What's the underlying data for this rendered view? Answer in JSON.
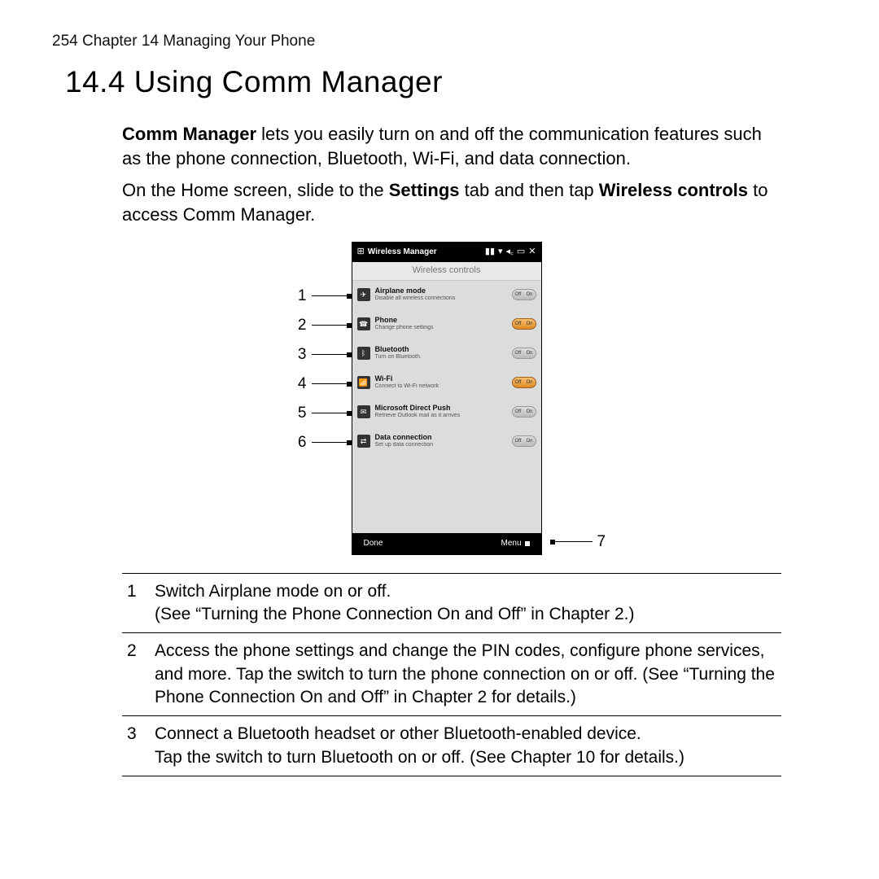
{
  "header": {
    "running": "254  Chapter 14  Managing Your Phone",
    "title": "14.4  Using Comm Manager"
  },
  "intro": {
    "p1_lead": "Comm Manager",
    "p1_rest": " lets you easily turn on and off the communication features such as the phone connection, Bluetooth, Wi-Fi, and data connection.",
    "p2_a": "On the Home screen, slide to the ",
    "p2_b": "Settings",
    "p2_c": " tab and then tap ",
    "p2_d": "Wireless controls",
    "p2_e": " to access Comm Manager."
  },
  "phone": {
    "status_title": "Wireless Manager",
    "subhead": "Wireless controls",
    "items": [
      {
        "icon": "✈",
        "title": "Airplane mode",
        "desc": "Disable all wireless connections",
        "state": "off"
      },
      {
        "icon": "☎",
        "title": "Phone",
        "desc": "Change phone settings",
        "state": "on"
      },
      {
        "icon": "ᛒ",
        "title": "Bluetooth",
        "desc": "Turn on Bluetooth.",
        "state": "off"
      },
      {
        "icon": "📶",
        "title": "Wi-Fi",
        "desc": "Connect to Wi-Fi network",
        "state": "on"
      },
      {
        "icon": "✉",
        "title": "Microsoft Direct Push",
        "desc": "Retrieve Outlook mail as it arrives",
        "state": "off"
      },
      {
        "icon": "⇄",
        "title": "Data connection",
        "desc": "Set up data connection",
        "state": "off"
      }
    ],
    "toggle_off": "Off",
    "toggle_on": "On",
    "done": "Done",
    "menu": "Menu"
  },
  "callouts": {
    "left": [
      "1",
      "2",
      "3",
      "4",
      "5",
      "6"
    ],
    "right": "7"
  },
  "legend": [
    {
      "n": "1",
      "t": "Switch Airplane mode on or off.\n(See “Turning the Phone Connection On and Off” in Chapter 2.)"
    },
    {
      "n": "2",
      "t": "Access the phone settings and change the PIN codes, configure phone services, and more. Tap the switch to turn the phone connection on or off. (See “Turning the Phone Connection On and Off” in Chapter 2 for details.)"
    },
    {
      "n": "3",
      "t": "Connect a Bluetooth headset or other Bluetooth-enabled device.\nTap the switch to turn Bluetooth on or off. (See Chapter 10 for details.)"
    }
  ]
}
